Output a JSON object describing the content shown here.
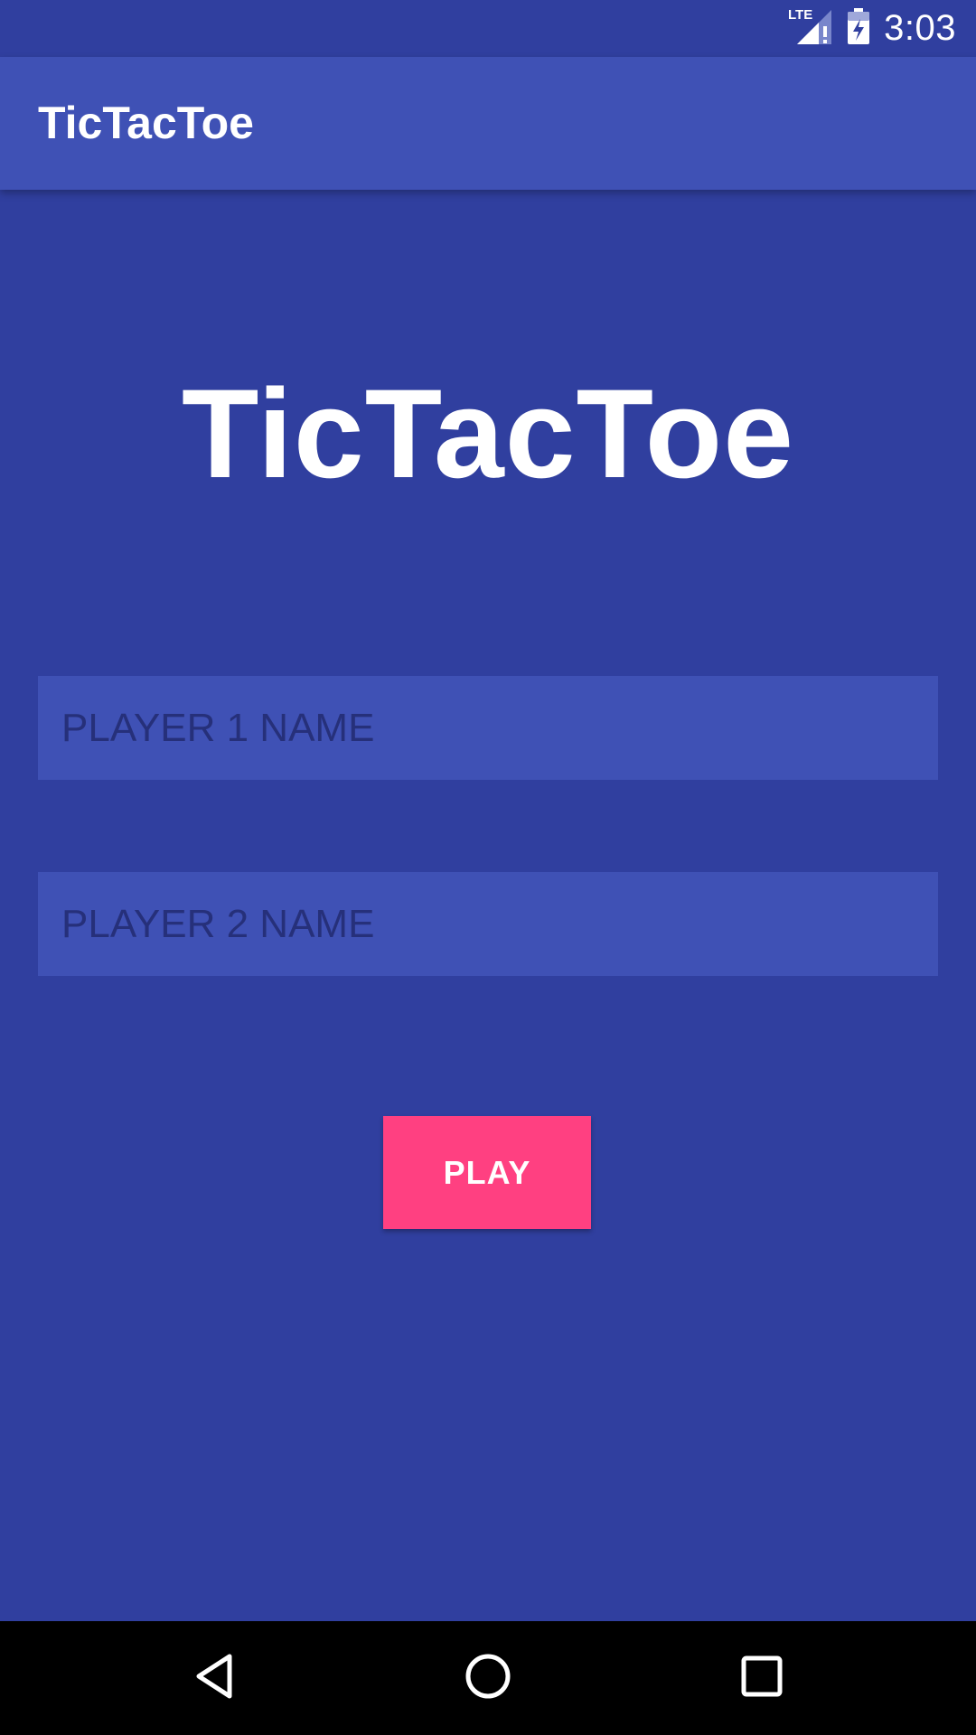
{
  "status_bar": {
    "network": "LTE",
    "time": "3:03",
    "icons": [
      "lte-signal-icon",
      "battery-charging-icon"
    ]
  },
  "app_bar": {
    "title": "TicTacToe"
  },
  "main": {
    "title": "TicTacToe",
    "player1": {
      "value": "",
      "placeholder": "PLAYER 1 NAME"
    },
    "player2": {
      "value": "",
      "placeholder": "PLAYER 2 NAME"
    },
    "play_label": "PLAY"
  },
  "nav_bar": {
    "icons": [
      "back-icon",
      "home-icon",
      "recents-icon"
    ]
  },
  "colors": {
    "background": "#303f9f",
    "primary": "#3f51b5",
    "accent": "#ff4081",
    "nav_background": "#000000"
  }
}
